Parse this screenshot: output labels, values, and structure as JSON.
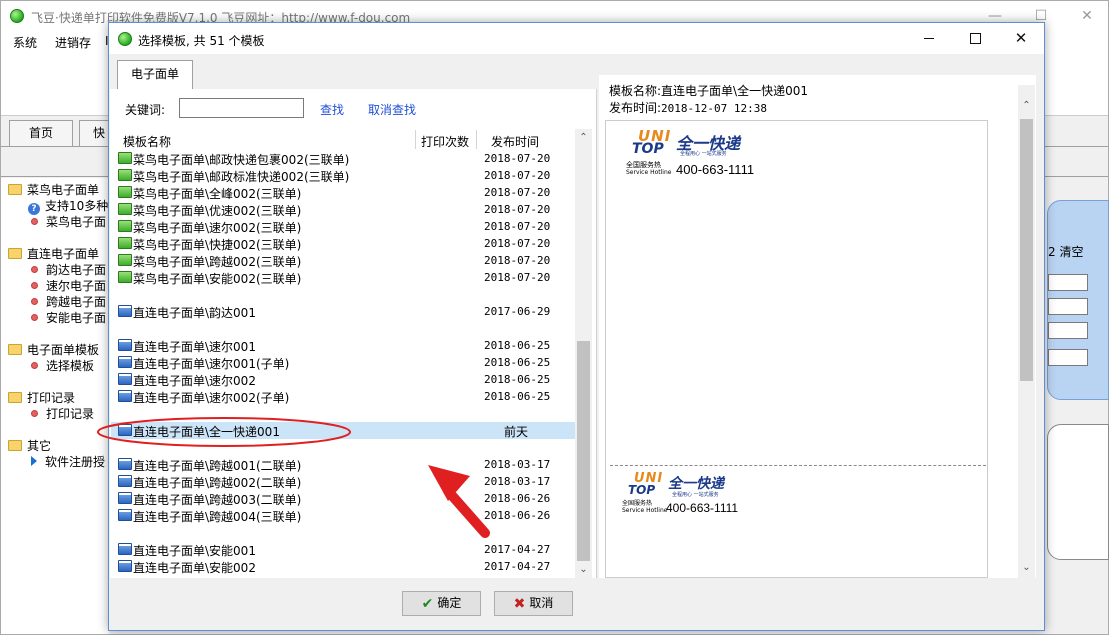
{
  "main_window": {
    "title": "飞豆·快递单打印软件免费版V7.1.0  飞豆网址：http://www.f-dou.com",
    "menu": [
      "系统",
      "进销存",
      "I"
    ],
    "tabs": [
      "首页",
      "快"
    ],
    "tree": [
      {
        "type": "folder",
        "label": "菜鸟电子面单"
      },
      {
        "type": "help",
        "label": "支持10多种"
      },
      {
        "type": "leaf",
        "label": "菜鸟电子面"
      },
      {
        "type": "folder",
        "label": "直连电子面单"
      },
      {
        "type": "leaf",
        "label": "韵达电子面"
      },
      {
        "type": "leaf",
        "label": "速尔电子面"
      },
      {
        "type": "leaf",
        "label": "跨越电子面"
      },
      {
        "type": "leaf",
        "label": "安能电子面"
      },
      {
        "type": "folder",
        "label": "电子面单模板"
      },
      {
        "type": "leaf",
        "label": "选择模板"
      },
      {
        "type": "folder",
        "label": "打印记录"
      },
      {
        "type": "leaf",
        "label": "打印记录"
      },
      {
        "type": "folder",
        "label": "其它"
      },
      {
        "type": "arrow",
        "label": "软件注册授"
      }
    ],
    "right_panel_label": "2 清空"
  },
  "dialog": {
    "title": "选择模板, 共 51 个模板",
    "tab": "电子面单",
    "search": {
      "label": "关键词:",
      "value": "",
      "find": "查找",
      "cancel_find": "取消查找"
    },
    "columns": {
      "name": "模板名称",
      "count": "打印次数",
      "date": "发布时间"
    },
    "rows": [
      {
        "name": "菜鸟电子面单\\邮政快递包裹002(三联单)",
        "date": "2018-07-20",
        "icon": "green"
      },
      {
        "name": "菜鸟电子面单\\邮政标准快递002(三联单)",
        "date": "2018-07-20",
        "icon": "green"
      },
      {
        "name": "菜鸟电子面单\\全峰002(三联单)",
        "date": "2018-07-20",
        "icon": "green"
      },
      {
        "name": "菜鸟电子面单\\优速002(三联单)",
        "date": "2018-07-20",
        "icon": "green"
      },
      {
        "name": "菜鸟电子面单\\速尔002(三联单)",
        "date": "2018-07-20",
        "icon": "green"
      },
      {
        "name": "菜鸟电子面单\\快捷002(三联单)",
        "date": "2018-07-20",
        "icon": "green"
      },
      {
        "name": "菜鸟电子面单\\跨越002(三联单)",
        "date": "2018-07-20",
        "icon": "green"
      },
      {
        "name": "菜鸟电子面单\\安能002(三联单)",
        "date": "2018-07-20",
        "icon": "green"
      },
      {
        "name": "",
        "date": "",
        "icon": "none"
      },
      {
        "name": "直连电子面单\\韵达001",
        "date": "2017-06-29",
        "icon": "blue"
      },
      {
        "name": "",
        "date": "",
        "icon": "none"
      },
      {
        "name": "直连电子面单\\速尔001",
        "date": "2018-06-25",
        "icon": "blue"
      },
      {
        "name": "直连电子面单\\速尔001(子单)",
        "date": "2018-06-25",
        "icon": "blue"
      },
      {
        "name": "直连电子面单\\速尔002",
        "date": "2018-06-25",
        "icon": "blue"
      },
      {
        "name": "直连电子面单\\速尔002(子单)",
        "date": "2018-06-25",
        "icon": "blue"
      },
      {
        "name": "",
        "date": "",
        "icon": "none"
      },
      {
        "name": "直连电子面单\\全一快递001",
        "date": "前天",
        "icon": "blue",
        "selected": true
      },
      {
        "name": "",
        "date": "",
        "icon": "none"
      },
      {
        "name": "直连电子面单\\跨越001(二联单)",
        "date": "2018-03-17",
        "icon": "blue"
      },
      {
        "name": "直连电子面单\\跨越002(二联单)",
        "date": "2018-03-17",
        "icon": "blue"
      },
      {
        "name": "直连电子面单\\跨越003(二联单)",
        "date": "2018-06-26",
        "icon": "blue"
      },
      {
        "name": "直连电子面单\\跨越004(三联单)",
        "date": "2018-06-26",
        "icon": "blue"
      },
      {
        "name": "",
        "date": "",
        "icon": "none"
      },
      {
        "name": "直连电子面单\\安能001",
        "date": "2017-04-27",
        "icon": "blue"
      },
      {
        "name": "直连电子面单\\安能002",
        "date": "2017-04-27",
        "icon": "blue"
      }
    ],
    "preview": {
      "name_label": "模板名称:",
      "name_value": "直连电子面单\\全一快递001",
      "time_label": "发布时间:",
      "time_value": "2018-12-07 12:38",
      "logo_uni": "UNI",
      "logo_top": "TOP",
      "logo_cn": "全一快递",
      "logo_tag": "全程用心  一站式服务",
      "service_cn": "全国服务热",
      "service_en": "Service Hotline",
      "phone": "400-663-1111"
    },
    "ok_label": "确定",
    "cancel_label": "取消"
  },
  "colors": {
    "selection": "#cce4f7",
    "link": "#1d4fd8",
    "annotation": "#e02020",
    "logo_orange": "#e8891c",
    "logo_blue": "#1c3a8a"
  }
}
